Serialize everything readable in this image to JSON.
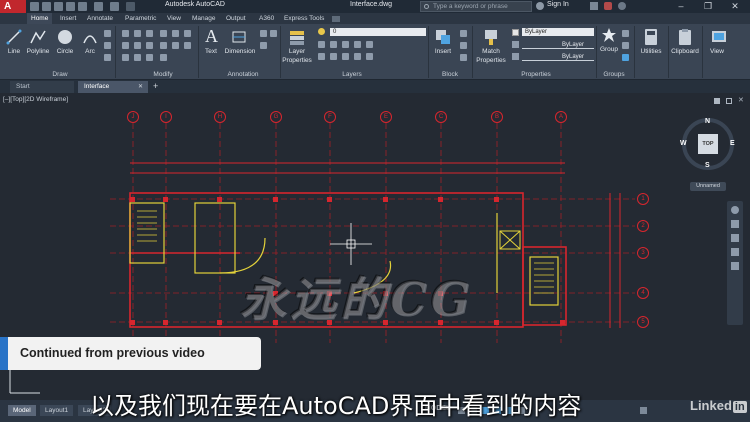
{
  "app": {
    "logo": "A",
    "title": "Autodesk AutoCAD",
    "file": "Interface.dwg"
  },
  "search": {
    "placeholder": "Type a keyword or phrase"
  },
  "account": {
    "sign_in": "Sign In"
  },
  "window_controls": {
    "minimize": "–",
    "restore": "❐",
    "close": "✕"
  },
  "ribbon_tabs": [
    "Home",
    "Insert",
    "Annotate",
    "Parametric",
    "View",
    "Manage",
    "Output",
    "A360",
    "Express Tools"
  ],
  "ribbon": {
    "draw": {
      "line": "Line",
      "polyline": "Polyline",
      "circle": "Circle",
      "arc": "Arc",
      "title": "Draw"
    },
    "modify": {
      "title": "Modify"
    },
    "annotation": {
      "text": "Text",
      "dimension": "Dimension",
      "title": "Annotation"
    },
    "layers": {
      "layer_properties_1": "Layer",
      "layer_properties_2": "Properties",
      "current_layer": "0",
      "title": "Layers"
    },
    "block": {
      "insert": "Insert",
      "title": "Block"
    },
    "properties": {
      "match_1": "Match",
      "match_2": "Properties",
      "color": "ByLayer",
      "linetype": "ByLayer",
      "lineweight": "ByLayer",
      "title": "Properties"
    },
    "groups": {
      "group": "Group",
      "title": "Groups"
    },
    "utilities": {
      "label": "Utilities"
    },
    "clipboard": {
      "label": "Clipboard"
    },
    "view": {
      "label": "View"
    }
  },
  "doc_tabs": {
    "start": "Start",
    "interface": "Interface",
    "new": "+"
  },
  "viewport": {
    "label": "[–][Top][2D Wireframe]",
    "viewcube_top": "TOP",
    "n": "N",
    "s": "S",
    "e": "E",
    "w": "W",
    "ucs": "Unnamed"
  },
  "grid_columns": [
    "J",
    "I",
    "H",
    "G",
    "F",
    "E",
    "C",
    "B",
    "A"
  ],
  "grid_rows": [
    "1",
    "2",
    "3",
    "4",
    "5",
    "6"
  ],
  "layout_tabs": [
    "Model",
    "Layout1",
    "Layout2"
  ],
  "status": {
    "model": "MODEL"
  },
  "overlay": {
    "continued": "Continued from previous video",
    "subtitle": "以及我们现在要在AutoCAD界面中看到的内容",
    "watermark": "永远的CG",
    "brand": "Linked",
    "brand_in": "in"
  },
  "colors": {
    "titlebar": "#202a36",
    "ribbon": "#3a4554",
    "canvas": "#242a33",
    "accent": "#2a74c7",
    "grid_red": "#d7262e",
    "wall_yellow": "#e3d23a"
  }
}
